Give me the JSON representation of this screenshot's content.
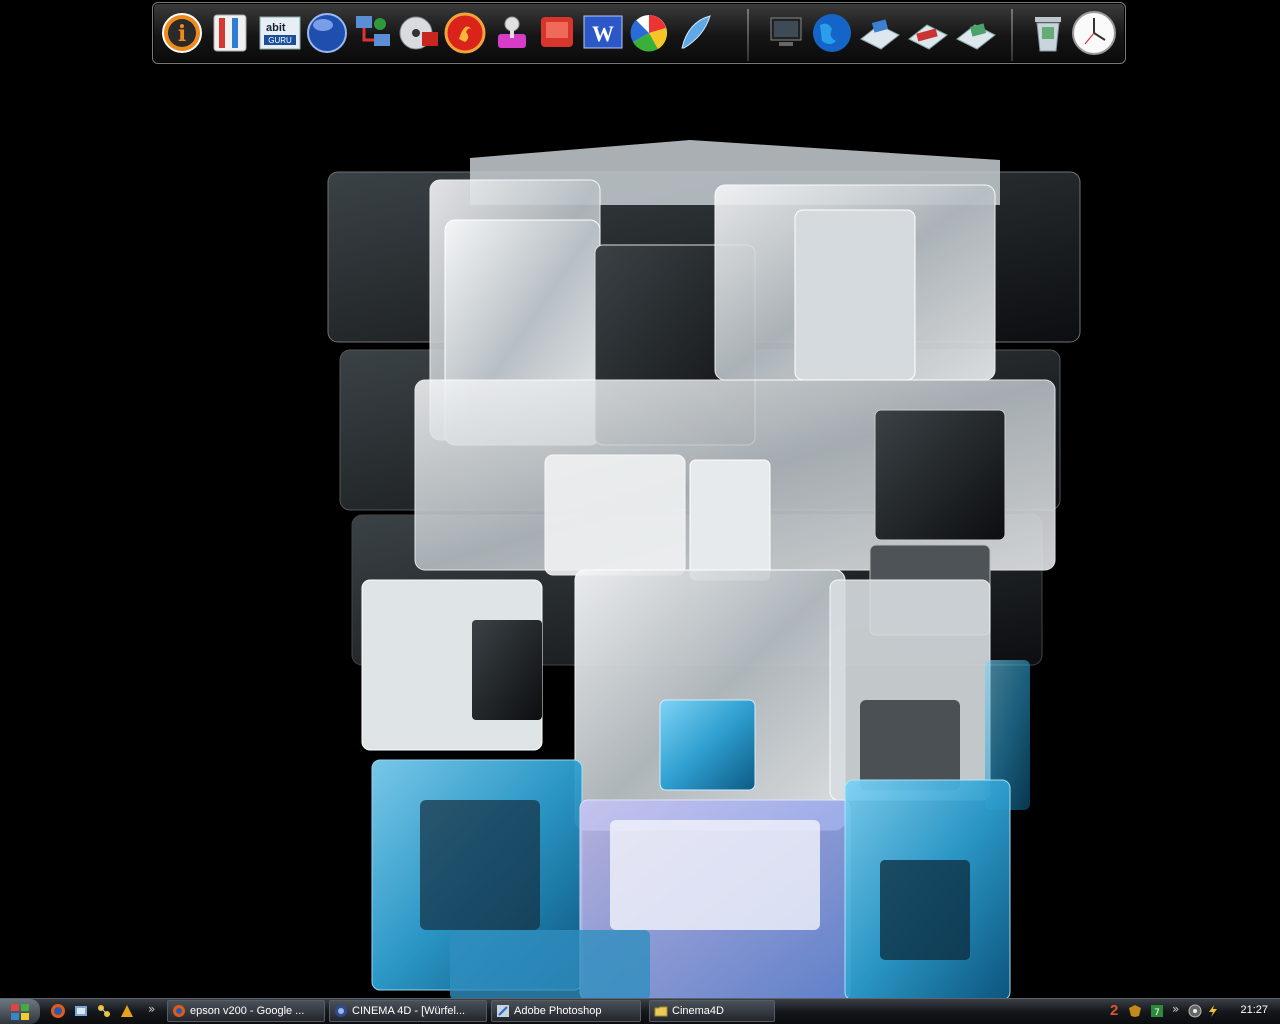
{
  "dock": {
    "items": [
      {
        "name": "info-icon"
      },
      {
        "name": "thermometer-icon"
      },
      {
        "name": "abit-guru-icon",
        "label": "abit GURU"
      },
      {
        "name": "blue-orb-icon"
      },
      {
        "name": "network-icon"
      },
      {
        "name": "dvd-burn-icon"
      },
      {
        "name": "firefox-icon"
      },
      {
        "name": "keys-icon"
      },
      {
        "name": "photo-app-icon"
      },
      {
        "name": "word-icon",
        "label": "W"
      },
      {
        "name": "picasa-icon"
      },
      {
        "name": "feather-icon"
      },
      {
        "name": "my-computer-icon"
      },
      {
        "name": "globe-icon"
      },
      {
        "name": "photos-folder-icon"
      },
      {
        "name": "video-folder-icon"
      },
      {
        "name": "images-folder-icon"
      },
      {
        "name": "recycle-bin-icon"
      },
      {
        "name": "clock-icon"
      }
    ]
  },
  "taskbar": {
    "tasks": [
      {
        "label": "epson v200 - Google ..."
      },
      {
        "label": "CINEMA 4D - [Würfel..."
      },
      {
        "label": "Adobe Photoshop"
      },
      {
        "label": "Cinema4D"
      }
    ],
    "tray_badge": "2",
    "clock": "21:27",
    "chevron": "»"
  },
  "colors": {
    "cube_blue": "#3fa9d8",
    "cube_glass": "#d9dee2",
    "background": "#000000"
  }
}
